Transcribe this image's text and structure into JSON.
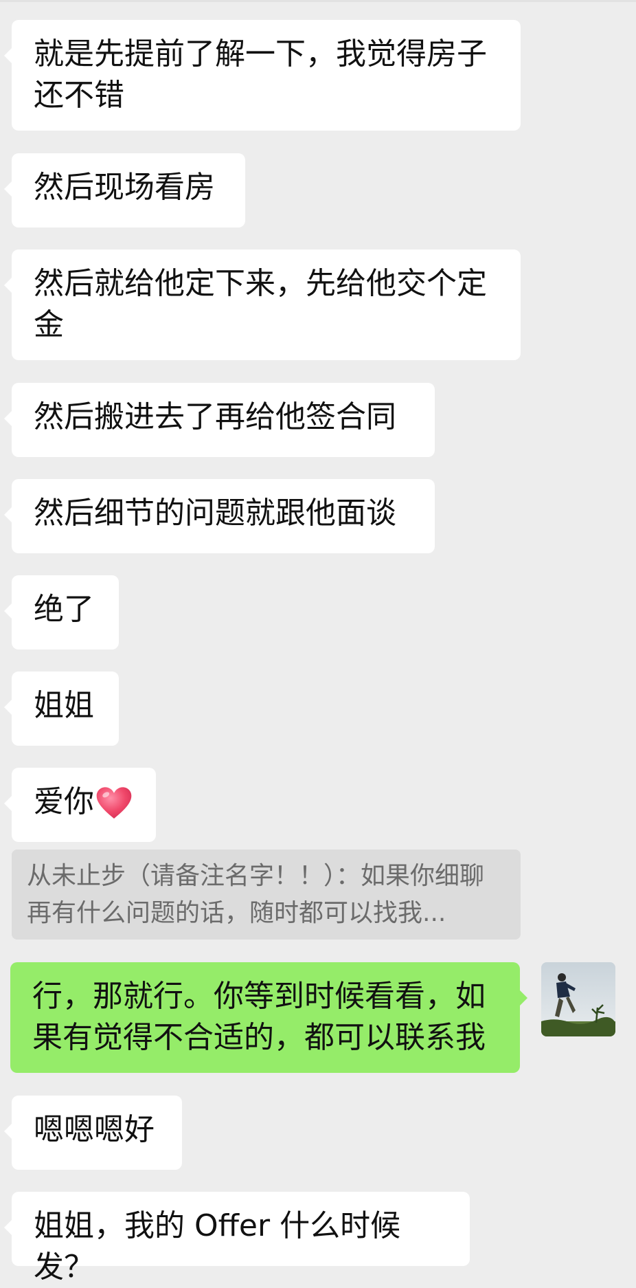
{
  "chat": {
    "messages": [
      {
        "text": "就是先提前了解一下，我觉得房子还不错"
      },
      {
        "text": "然后现场看房"
      },
      {
        "text": "然后就给他定下来，先给他交个定金"
      },
      {
        "text": "然后搬进去了再给他签合同"
      },
      {
        "text": "然后细节的问题就跟他面谈"
      },
      {
        "text": "绝了"
      },
      {
        "text": "姐姐"
      },
      {
        "text": "爱你",
        "emoji": "heart-icon"
      },
      {
        "quote": "从未止步（请备注名字！！）：如果你细聊再有什么问题的话，随时都可以找我..."
      },
      {
        "text": "行，那就行。你等到时候看看，如果有觉得不合适的，都可以联系我"
      },
      {
        "text": "嗯嗯嗯好"
      },
      {
        "text": "姐姐，我的 Offer 什么时候发？"
      }
    ]
  },
  "colors": {
    "background": "#ededed",
    "incoming_bubble": "#ffffff",
    "outgoing_bubble": "#95ec69",
    "quote_bubble": "#dcdcdc",
    "heart": "#f0486a"
  }
}
